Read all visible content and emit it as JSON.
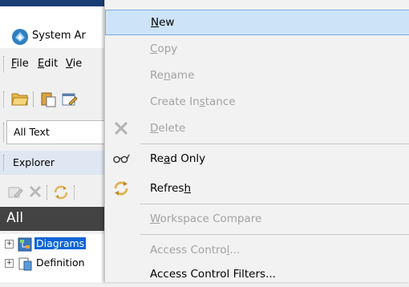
{
  "app": {
    "title": "System Ar",
    "menu": [
      {
        "key": "F",
        "rest": "ile"
      },
      {
        "key": "E",
        "rest": "dit"
      },
      {
        "key": "V",
        "rest": "ie"
      }
    ],
    "filter_value": "All Text",
    "explorer_label": "Explorer",
    "all_label": "All",
    "tree": [
      {
        "label": "Diagrams",
        "selected": true,
        "icon": "diagrams-icon"
      },
      {
        "label": "Definition",
        "selected": false,
        "icon": "definitions-icon"
      }
    ]
  },
  "context_menu": {
    "items": [
      {
        "id": "new",
        "pre": "",
        "key": "N",
        "post": "ew",
        "enabled": true,
        "highlighted": true,
        "icon": ""
      },
      {
        "id": "copy",
        "pre": "",
        "key": "C",
        "post": "opy",
        "enabled": false,
        "icon": ""
      },
      {
        "id": "rename",
        "pre": "Re",
        "key": "n",
        "post": "ame",
        "enabled": false,
        "icon": ""
      },
      {
        "id": "create-instance",
        "pre": "Create In",
        "key": "s",
        "post": "tance",
        "enabled": false,
        "icon": ""
      },
      {
        "id": "delete",
        "pre": "",
        "key": "D",
        "post": "elete",
        "enabled": false,
        "icon": "delete-icon"
      },
      {
        "id": "read-only",
        "pre": "Re",
        "key": "a",
        "post": "d Only",
        "enabled": true,
        "icon": "read-only-glasses-icon"
      },
      {
        "id": "refresh",
        "pre": "Refres",
        "key": "h",
        "post": "",
        "enabled": true,
        "icon": "refresh-icon"
      },
      {
        "id": "workspace-compare",
        "pre": "",
        "key": "W",
        "post": "orkspace Compare",
        "enabled": false,
        "icon": ""
      },
      {
        "id": "access-control",
        "pre": "Access Contro",
        "key": "l",
        "post": "...",
        "enabled": false,
        "icon": ""
      },
      {
        "id": "access-control-filters",
        "pre": "Access Control Filters...",
        "key": "",
        "post": "",
        "enabled": true,
        "icon": ""
      }
    ]
  },
  "colors": {
    "accent": "#0a64d8",
    "highlight_bg": "#cde3f8",
    "highlight_border": "#78aee5",
    "disabled_text": "#a2a2a2",
    "all_bar": "#434343"
  }
}
